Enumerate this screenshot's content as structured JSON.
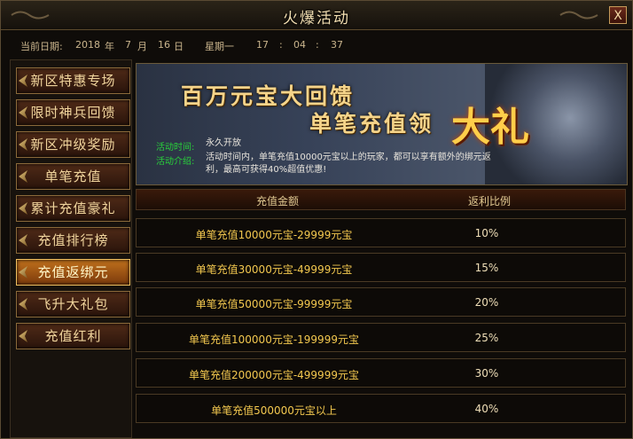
{
  "window": {
    "title": "火爆活动",
    "close_label": "X"
  },
  "date": {
    "label": "当前日期:",
    "year": "2018",
    "year_unit": "年",
    "month": "7",
    "month_unit": "月",
    "day": "16",
    "day_unit": "日",
    "weekday": "星期一",
    "hour": "17",
    "sep1": ":",
    "minute": "04",
    "sep2": ":",
    "second": "37"
  },
  "sidebar": {
    "items": [
      {
        "label": "新区特惠专场"
      },
      {
        "label": "限时神兵回馈"
      },
      {
        "label": "新区冲级奖励"
      },
      {
        "label": "单笔充值"
      },
      {
        "label": "累计充值豪礼"
      },
      {
        "label": "充值排行榜"
      },
      {
        "label": "充值返绑元"
      },
      {
        "label": "飞升大礼包"
      },
      {
        "label": "充值红利"
      }
    ],
    "active_index": 6
  },
  "banner": {
    "line1": "百万元宝大回馈",
    "line2": "单笔充值领",
    "big": "大礼",
    "time_label": "活动时间:",
    "time_value": "永久开放",
    "desc_label": "活动介绍:",
    "desc_line1": "活动时间内，单笔充值10000元宝以上的玩家，都可以享有额外的绑元返",
    "desc_line2": "利，最高可获得40%超值优惠!"
  },
  "table": {
    "headers": [
      "充值金额",
      "返利比例"
    ],
    "rows": [
      {
        "amount": "单笔充值10000元宝-29999元宝",
        "rate": "10%"
      },
      {
        "amount": "单笔充值30000元宝-49999元宝",
        "rate": "15%"
      },
      {
        "amount": "单笔充值50000元宝-99999元宝",
        "rate": "20%"
      },
      {
        "amount": "单笔充值100000元宝-199999元宝",
        "rate": "25%"
      },
      {
        "amount": "单笔充值200000元宝-499999元宝",
        "rate": "30%"
      },
      {
        "amount": "单笔充值500000元宝以上",
        "rate": "40%"
      }
    ]
  },
  "colors": {
    "accent_gold": "#f3c84f",
    "info_label_green": "#29d13b",
    "active_tab": "#c0701c"
  }
}
